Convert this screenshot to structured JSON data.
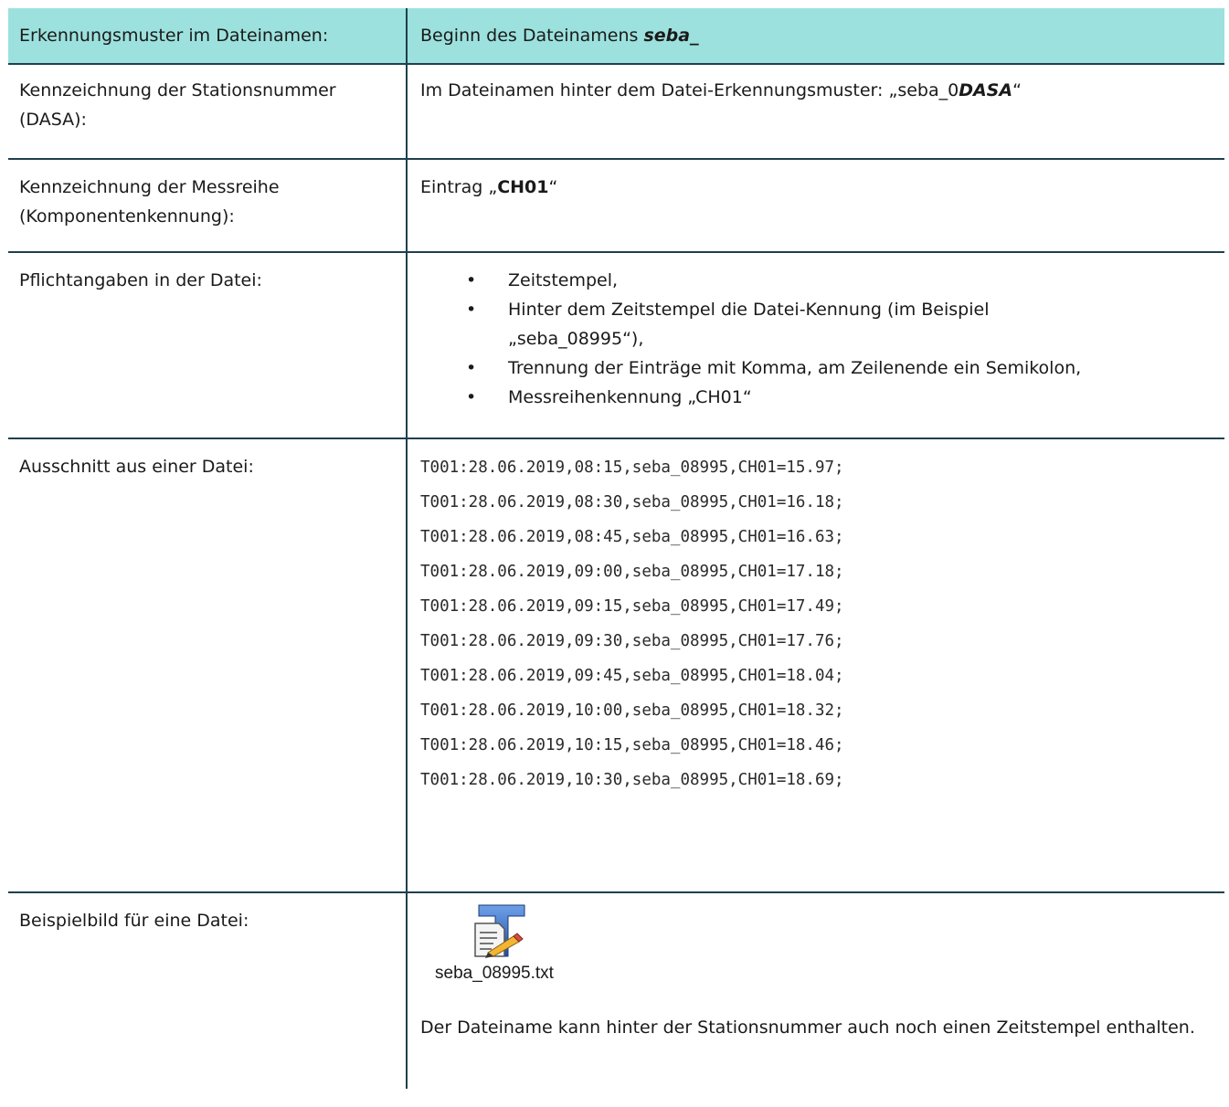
{
  "header": {
    "label": "Erkennungsmuster im Dateinamen:",
    "value_prefix": "Beginn des Dateinamens ",
    "value_emph": "seba_"
  },
  "station": {
    "label_line1": "Kennzeichnung der Stationsnummer",
    "label_line2": "(DASA):",
    "value_prefix": "Im Dateinamen hinter dem Datei-Erkennungsmuster: „seba_0",
    "value_emph": "DASA",
    "value_suffix": "“"
  },
  "series": {
    "label_line1": "Kennzeichnung der Messreihe",
    "label_line2": "(Komponentenkennung):",
    "value_prefix": "Eintrag „",
    "value_emph": "CH01",
    "value_suffix": "“"
  },
  "mandatory": {
    "label": "Pflichtangaben in der Datei:",
    "bullet": "•",
    "items": [
      "Zeitstempel,",
      "Hinter dem Zeitstempel die Datei-Kennung (im Beispiel",
      "Trennung der Einträge mit Komma, am Zeilenende ein Semikolon,",
      "Messreihenkennung „CH01“"
    ],
    "item2_cont": "„seba_08995“),"
  },
  "excerpt": {
    "label": "Ausschnitt aus einer Datei:",
    "lines": [
      "T001:28.06.2019,08:15,seba_08995,CH01=15.97;",
      "T001:28.06.2019,08:30,seba_08995,CH01=16.18;",
      "T001:28.06.2019,08:45,seba_08995,CH01=16.63;",
      "T001:28.06.2019,09:00,seba_08995,CH01=17.18;",
      "T001:28.06.2019,09:15,seba_08995,CH01=17.49;",
      "T001:28.06.2019,09:30,seba_08995,CH01=17.76;",
      "T001:28.06.2019,09:45,seba_08995,CH01=18.04;",
      "T001:28.06.2019,10:00,seba_08995,CH01=18.32;",
      "T001:28.06.2019,10:15,seba_08995,CH01=18.46;",
      "T001:28.06.2019,10:30,seba_08995,CH01=18.69;"
    ]
  },
  "example": {
    "label": "Beispielbild für eine Datei:",
    "icon": "text-file-icon",
    "filename": "seba_08995.txt",
    "note": "Der Dateiname kann hinter der Stationsnummer auch noch einen Zeitstempel enthalten."
  },
  "colors": {
    "header_bg": "#9ce1dd",
    "rule": "#1f3f4f"
  }
}
